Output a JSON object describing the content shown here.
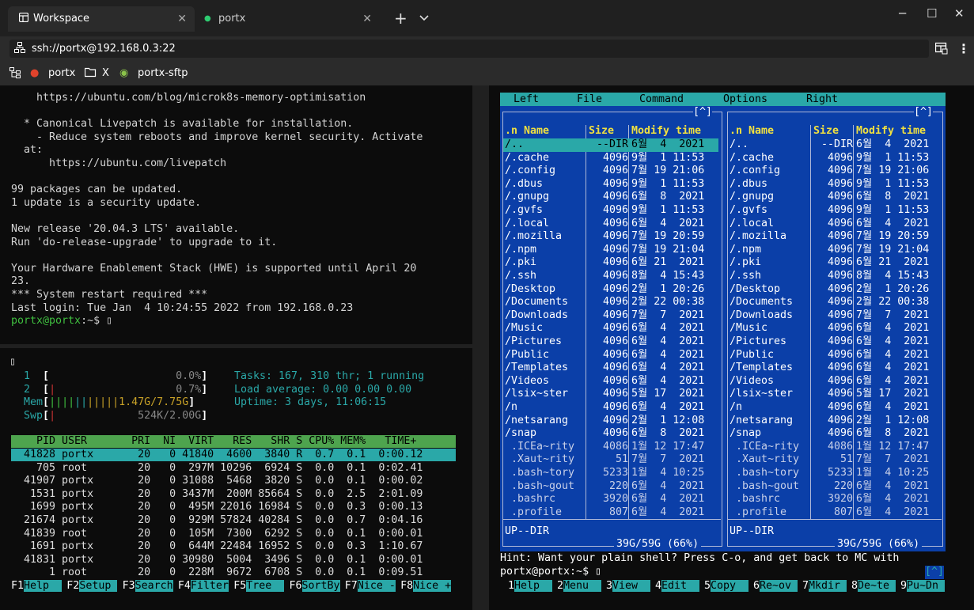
{
  "tabs": [
    {
      "label": "Workspace",
      "icon": "grid-icon"
    },
    {
      "label": "portx",
      "icon": "dot-icon"
    }
  ],
  "address": {
    "value": "ssh://portx@192.168.0.3:22"
  },
  "sessions": [
    {
      "label": "portx",
      "icon": "terminal-icon"
    },
    {
      "label": "X",
      "icon": "folder-icon"
    },
    {
      "label": "portx-sftp",
      "icon": "sftp-icon"
    }
  ],
  "terminal": {
    "lines": [
      "    https://ubuntu.com/blog/microk8s-memory-optimisation",
      "",
      "  * Canonical Livepatch is available for installation.",
      "    - Reduce system reboots and improve kernel security. Activate",
      "  at:",
      "      https://ubuntu.com/livepatch",
      "",
      "99 packages can be updated.",
      "1 update is a security update.",
      "",
      "New release '20.04.3 LTS' available.",
      "Run 'do-release-upgrade' to upgrade to it.",
      "",
      "Your Hardware Enablement Stack (HWE) is supported until April 20",
      "23.",
      "*** System restart required ***",
      "Last login: Tue Jan  4 10:24:55 2022 from 192.168.0.23"
    ],
    "prompt": "portx@portx",
    "prompt_suffix": ":~$ "
  },
  "htop": {
    "cpu1_label": "1",
    "cpu1_val": "0.0%",
    "cpu2_label": "2",
    "cpu2_val": "0.7%",
    "mem_label": "Mem",
    "mem_val": "1.47G/7.75G",
    "swp_label": "Swp",
    "swp_val": "524K/2.00G",
    "tasks": "Tasks: 167, 310 thr; 1 running",
    "load": "Load average: 0.00 0.00 0.00",
    "uptime": "Uptime: 3 days, 11:06:15",
    "header": "    PID USER       PRI  NI  VIRT   RES   SHR S CPU% MEM%   TIME+",
    "rows": [
      "  41828 portx       20   0 41840  4600  3840 R  0.7  0.1  0:00.12",
      "    705 root        20   0  297M 10296  6924 S  0.0  0.1  0:02.41",
      "  41907 portx       20   0 31088  5468  3820 S  0.0  0.1  0:00.02",
      "   1531 portx       20   0 3437M  200M 85664 S  0.0  2.5  2:01.09",
      "   1699 portx       20   0  495M 22016 16984 S  0.0  0.3  0:00.13",
      "  21674 portx       20   0  929M 57824 40284 S  0.0  0.7  0:04.16",
      "  41839 root        20   0  105M  7300  6292 S  0.0  0.1  0:00.01",
      "   1691 portx       20   0  644M 22484 16952 S  0.0  0.3  1:10.67",
      "  41831 portx       20   0 30980  5004  3496 S  0.0  0.1  0:00.01",
      "      1 root        20   0  228M  9672  6708 S  0.0  0.1  0:09.51"
    ],
    "fkeys": [
      {
        "k": "F1",
        "l": "Help  "
      },
      {
        "k": "F2",
        "l": "Setup "
      },
      {
        "k": "F3",
        "l": "Search"
      },
      {
        "k": "F4",
        "l": "Filter"
      },
      {
        "k": "F5",
        "l": "Tree  "
      },
      {
        "k": "F6",
        "l": "SortBy"
      },
      {
        "k": "F7",
        "l": "Nice -"
      },
      {
        "k": "F8",
        "l": "Nice +"
      }
    ]
  },
  "mc": {
    "menu": [
      "Left",
      "File",
      "Command",
      "Options",
      "Right"
    ],
    "col_n": ".n",
    "col_name": "Name",
    "col_size": "Size",
    "col_modify": "Modify time",
    "entries": [
      [
        "/..",
        "--DIR",
        "6월  4  2021"
      ],
      [
        "/.cache",
        "4096",
        "9월  1 11:53"
      ],
      [
        "/.config",
        "4096",
        "7월 19 21:06"
      ],
      [
        "/.dbus",
        "4096",
        "9월  1 11:53"
      ],
      [
        "/.gnupg",
        "4096",
        "6월  8  2021"
      ],
      [
        "/.gvfs",
        "4096",
        "9월  1 11:53"
      ],
      [
        "/.local",
        "4096",
        "6월  4  2021"
      ],
      [
        "/.mozilla",
        "4096",
        "7월 19 20:59"
      ],
      [
        "/.npm",
        "4096",
        "7월 19 21:04"
      ],
      [
        "/.pki",
        "4096",
        "6월 21  2021"
      ],
      [
        "/.ssh",
        "4096",
        "8월  4 15:43"
      ],
      [
        "/Desktop",
        "4096",
        "2월  1 20:26"
      ],
      [
        "/Documents",
        "4096",
        "2월 22 00:38"
      ],
      [
        "/Downloads",
        "4096",
        "7월  7  2021"
      ],
      [
        "/Music",
        "4096",
        "6월  4  2021"
      ],
      [
        "/Pictures",
        "4096",
        "6월  4  2021"
      ],
      [
        "/Public",
        "4096",
        "6월  4  2021"
      ],
      [
        "/Templates",
        "4096",
        "6월  4  2021"
      ],
      [
        "/Videos",
        "4096",
        "6월  4  2021"
      ],
      [
        "/lsix~ster",
        "4096",
        "5월 17  2021"
      ],
      [
        "/n",
        "4096",
        "6월  4  2021"
      ],
      [
        "/netsarang",
        "4096",
        "2월  1 12:08"
      ],
      [
        "/snap",
        "4096",
        "6월  8  2021"
      ],
      [
        " .ICEa~rity",
        "4086",
        "1월 12 17:47"
      ],
      [
        " .Xaut~rity",
        "51",
        "7월  7  2021"
      ],
      [
        " .bash~tory",
        "5233",
        "1월  4 10:25"
      ],
      [
        " .bash~gout",
        "220",
        "6월  4  2021"
      ],
      [
        " .bashrc",
        "3920",
        "6월  4  2021"
      ],
      [
        " .profile",
        "807",
        "6월  4  2021"
      ]
    ],
    "status": "UP--DIR",
    "disk": "39G/59G (66%)",
    "hint": "Hint: Want your plain shell? Press C-o, and get back to MC with",
    "prompt": "portx@portx:~$ ",
    "corner": "[^]",
    "fkeys": [
      {
        "k": "1",
        "l": "Help  "
      },
      {
        "k": "2",
        "l": "Menu  "
      },
      {
        "k": "3",
        "l": "View  "
      },
      {
        "k": "4",
        "l": "Edit  "
      },
      {
        "k": "5",
        "l": "Copy  "
      },
      {
        "k": "6",
        "l": "Re~ov "
      },
      {
        "k": "7",
        "l": "Mkdir "
      },
      {
        "k": "8",
        "l": "De~te "
      },
      {
        "k": "9",
        "l": "Pu~Dn "
      }
    ]
  }
}
